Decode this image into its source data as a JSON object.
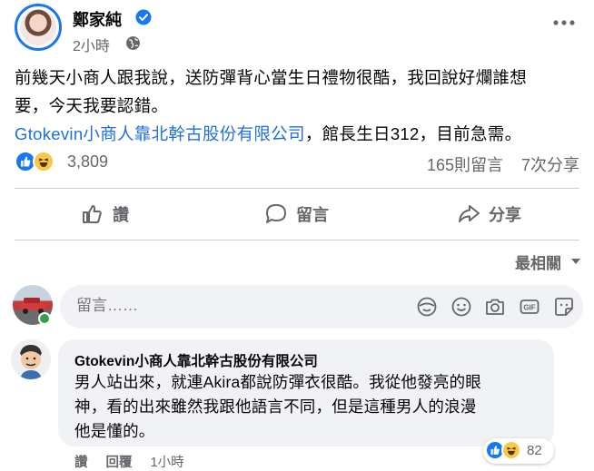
{
  "post": {
    "author": "鄭家純",
    "time": "2小時",
    "text_line1": "前幾天小商人跟我說，送防彈背心當生日禮物很酷，我回說好爛誰想",
    "text_line2": "要，今天我要認錯。",
    "link": "Gtokevin小商人靠北幹古股份有限公司",
    "text_line3_rest": "，館長生日312，目前急需。",
    "reaction_count": "3,809",
    "comment_count": "165則留言",
    "share_count": "7次分享"
  },
  "actions": {
    "like": "讚",
    "comment": "留言",
    "share": "分享"
  },
  "sort": {
    "label": "最相關"
  },
  "composer": {
    "placeholder": "留言……"
  },
  "comment": {
    "author": "Gtokevin小商人靠北幹古股份有限公司",
    "line1": "男人站出來，就連Akira都說防彈衣很酷。我從他發亮的眼",
    "line2": "神，看的出來雖然我跟他語言不同，但是這種男人的浪漫",
    "line3": "他是懂的。",
    "reaction_count": "82",
    "like_label": "讚",
    "reply_label": "回覆",
    "time": "1小時"
  },
  "colors": {
    "accent": "#1877f2",
    "link": "#216fdb",
    "muted": "#65676b",
    "bubble": "#f0f2f5"
  }
}
